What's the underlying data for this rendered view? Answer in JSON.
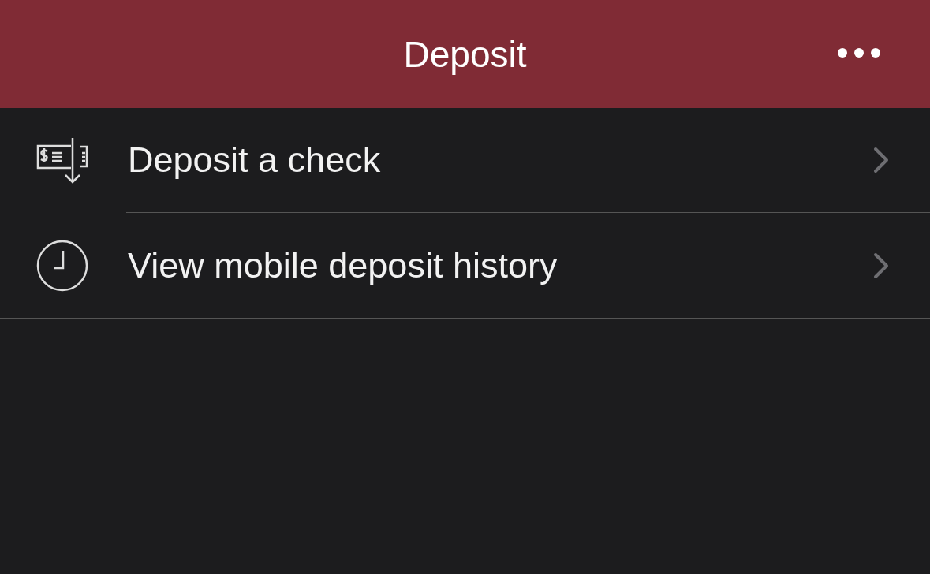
{
  "header": {
    "title": "Deposit"
  },
  "items": [
    {
      "kind": "check",
      "label": "Deposit a check"
    },
    {
      "kind": "history",
      "label": "View mobile deposit history"
    }
  ]
}
